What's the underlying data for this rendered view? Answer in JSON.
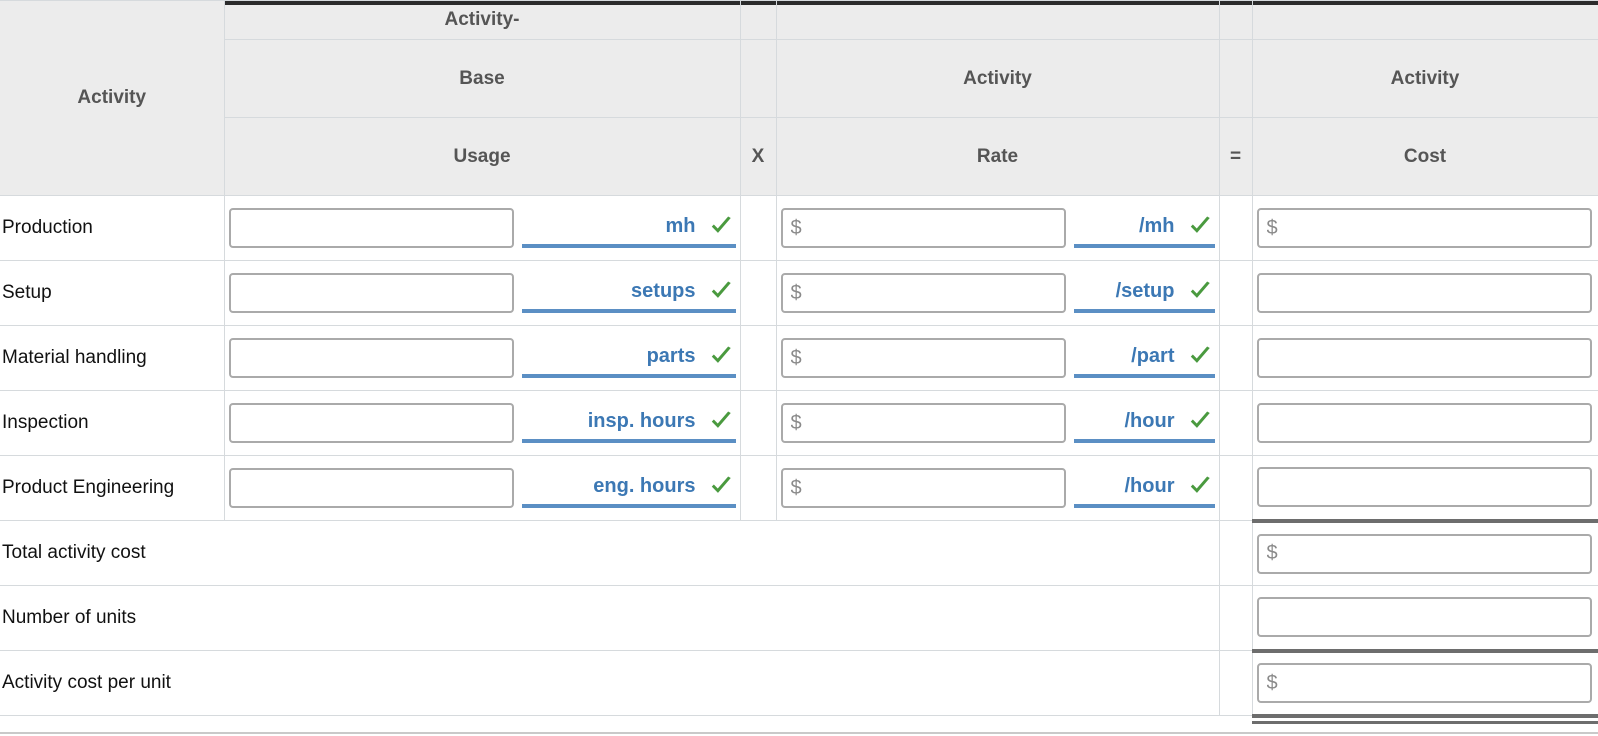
{
  "table": {
    "headers": {
      "activity": "Activity",
      "group_base": "Activity-",
      "base": "Base",
      "usage": "Usage",
      "times": "X",
      "group_rate": "Activity",
      "rate": "Rate",
      "equals": "=",
      "group_cost": "Activity",
      "cost": "Cost"
    },
    "rows": [
      {
        "activity": "Production",
        "usage_value": "",
        "usage_placeholder": "",
        "usage_unit": "mh",
        "usage_check": "check-icon",
        "rate_value": "",
        "rate_placeholder": "$",
        "rate_unit": "/mh",
        "rate_check": "check-icon",
        "cost_value": "",
        "cost_placeholder": "$"
      },
      {
        "activity": "Setup",
        "usage_value": "",
        "usage_placeholder": "",
        "usage_unit": "setups",
        "usage_check": "check-icon",
        "rate_value": "",
        "rate_placeholder": "$",
        "rate_unit": "/setup",
        "rate_check": "check-icon",
        "cost_value": "",
        "cost_placeholder": ""
      },
      {
        "activity": "Material handling",
        "usage_value": "",
        "usage_placeholder": "",
        "usage_unit": "parts",
        "usage_check": "check-icon",
        "rate_value": "",
        "rate_placeholder": "$",
        "rate_unit": "/part",
        "rate_check": "check-icon",
        "cost_value": "",
        "cost_placeholder": ""
      },
      {
        "activity": "Inspection",
        "usage_value": "",
        "usage_placeholder": "",
        "usage_unit": "insp. hours",
        "usage_check": "check-icon",
        "rate_value": "",
        "rate_placeholder": "$",
        "rate_unit": "/hour",
        "rate_check": "check-icon",
        "cost_value": "",
        "cost_placeholder": ""
      },
      {
        "activity": "Product Engineering",
        "usage_value": "",
        "usage_placeholder": "",
        "usage_unit": "eng. hours",
        "usage_check": "check-icon",
        "rate_value": "",
        "rate_placeholder": "$",
        "rate_unit": "/hour",
        "rate_check": "check-icon",
        "cost_value": "",
        "cost_placeholder": ""
      }
    ],
    "totals": [
      {
        "label": "Total activity cost",
        "value": "",
        "placeholder": "$"
      },
      {
        "label": " Number of units",
        "value": "",
        "placeholder": ""
      },
      {
        "label": "Activity cost per unit",
        "value": "",
        "placeholder": "$"
      }
    ]
  },
  "colors": {
    "header_bg": "#ececec",
    "header_text": "#555555",
    "grid_line": "#d6dadd",
    "unit_blue": "#3c78b4",
    "underline_blue": "#5b8fc4",
    "check_green": "#4a9a3f",
    "rule_dark": "#6d6d6d",
    "input_border": "#aaaaaa"
  }
}
